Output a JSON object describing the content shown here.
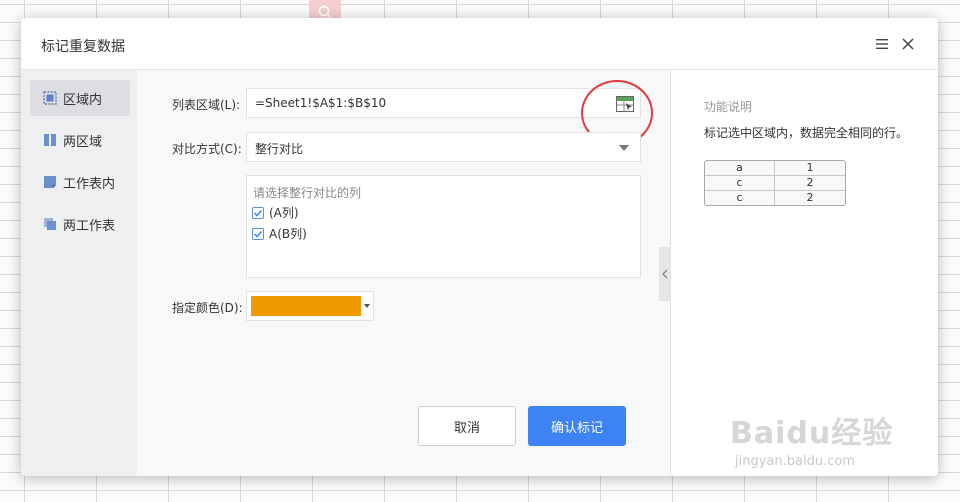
{
  "dialog": {
    "title": "标记重复数据"
  },
  "nav": {
    "items": [
      {
        "label": "区域内",
        "icon": "selection-box-icon",
        "active": true
      },
      {
        "label": "两区域",
        "icon": "two-columns-icon",
        "active": false
      },
      {
        "label": "工作表内",
        "icon": "sheet-icon",
        "active": false
      },
      {
        "label": "两工作表",
        "icon": "two-sheets-icon",
        "active": false
      }
    ]
  },
  "form": {
    "range_label": "列表区域(L):",
    "range_value": "=Sheet1!$A$1:$B$10",
    "compare_label": "对比方式(C):",
    "compare_value": "整行对比",
    "columns_hint": "请选择整行对比的列",
    "columns": [
      {
        "label": "(A列)",
        "checked": true
      },
      {
        "label": "A(B列)",
        "checked": true
      }
    ],
    "color_label": "指定颜色(D):",
    "color_value": "#f09a00",
    "cancel_label": "取消",
    "confirm_label": "确认标记"
  },
  "side": {
    "title": "功能说明",
    "description": "标记选中区域内，数据完全相同的行。",
    "example_rows": [
      [
        "a",
        "1"
      ],
      [
        "c",
        "2"
      ],
      [
        "c",
        "2"
      ]
    ]
  },
  "watermark": {
    "main": "Baidu经验",
    "sub": "jingyan.baidu.com"
  },
  "colors": {
    "accent": "#3d83f4",
    "highlight_circle": "#e53a3a"
  }
}
